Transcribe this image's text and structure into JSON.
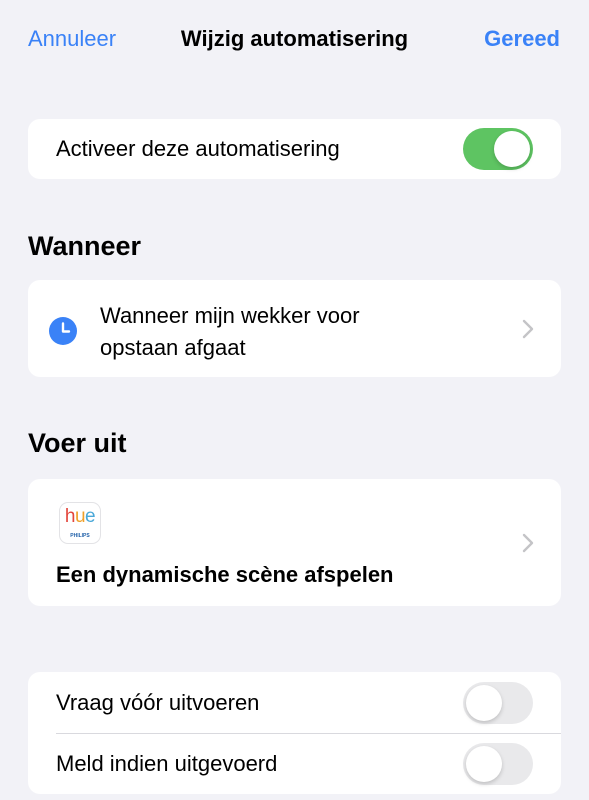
{
  "nav": {
    "cancel_label": "Annuleer",
    "title": "Wijzig automatisering",
    "done_label": "Gereed"
  },
  "enable": {
    "label": "Activeer deze automatisering",
    "on": true
  },
  "when": {
    "header": "Wanneer",
    "trigger_label": "Wanneer mijn wekker voor opstaan afgaat",
    "icon": "clock-icon"
  },
  "run": {
    "header": "Voer uit",
    "app_icon": "hue-icon",
    "app_logo_text": "hue",
    "app_logo_subtext": "PHILIPS",
    "action_label": "Een dynamische scène afspelen"
  },
  "options": [
    {
      "label": "Vraag vóór uitvoeren",
      "on": false
    },
    {
      "label": "Meld indien uitgevoerd",
      "on": false
    }
  ],
  "colors": {
    "accent": "#3a82f7",
    "toggle_on": "#5ec462",
    "toggle_off": "#e9e9eb",
    "background": "#f2f2f7"
  }
}
